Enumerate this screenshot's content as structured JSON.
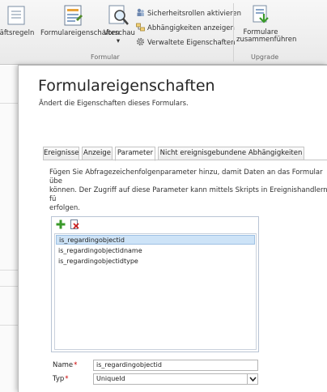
{
  "ribbon": {
    "partial_label": "äftsregeln",
    "form_properties_label": "Formulareigenschaften",
    "preview_label": "Vorschau",
    "preview_caret": "▾",
    "security_roles_label": "Sicherheitsrollen aktivieren",
    "dependencies_label": "Abhängigkeiten anzeigen",
    "managed_props_label": "Verwaltete Eigenschaften",
    "merge_label_1": "Formulare",
    "merge_label_2": "zusammenführen",
    "group_formular": "Formular",
    "group_upgrade": "Upgrade"
  },
  "dialog": {
    "title": "Formulareigenschaften",
    "subtitle": "Ändert die Eigenschaften dieses Formulars.",
    "tabs": [
      "Ereignisse",
      "Anzeige",
      "Parameter",
      "Nicht ereignisgebundene Abhängigkeiten"
    ],
    "active_tab": "Parameter",
    "description_1": "Fügen Sie Abfragezeichenfolgenparameter hinzu, damit Daten an das Formular übe",
    "description_2": "können. Der Zugriff auf diese Parameter kann mittels Skripts in Ereignishandlern fü",
    "description_3": "erfolgen.",
    "params": [
      "is_regardingobjectid",
      "is_regardingobjectidname",
      "is_regardingobjectidtype"
    ],
    "selected_param": "is_regardingobjectid",
    "name_label": "Name",
    "name_value": "is_regardingobjectid",
    "type_label": "Typ",
    "type_value": "UniqueId",
    "required_marker": "*"
  },
  "colors": {
    "selected_row": "#cde3f7",
    "required": "#cc0000",
    "add_icon": "#3a9a2a"
  },
  "icons": {
    "add": "green-plus-icon",
    "delete": "delete-document-icon"
  }
}
